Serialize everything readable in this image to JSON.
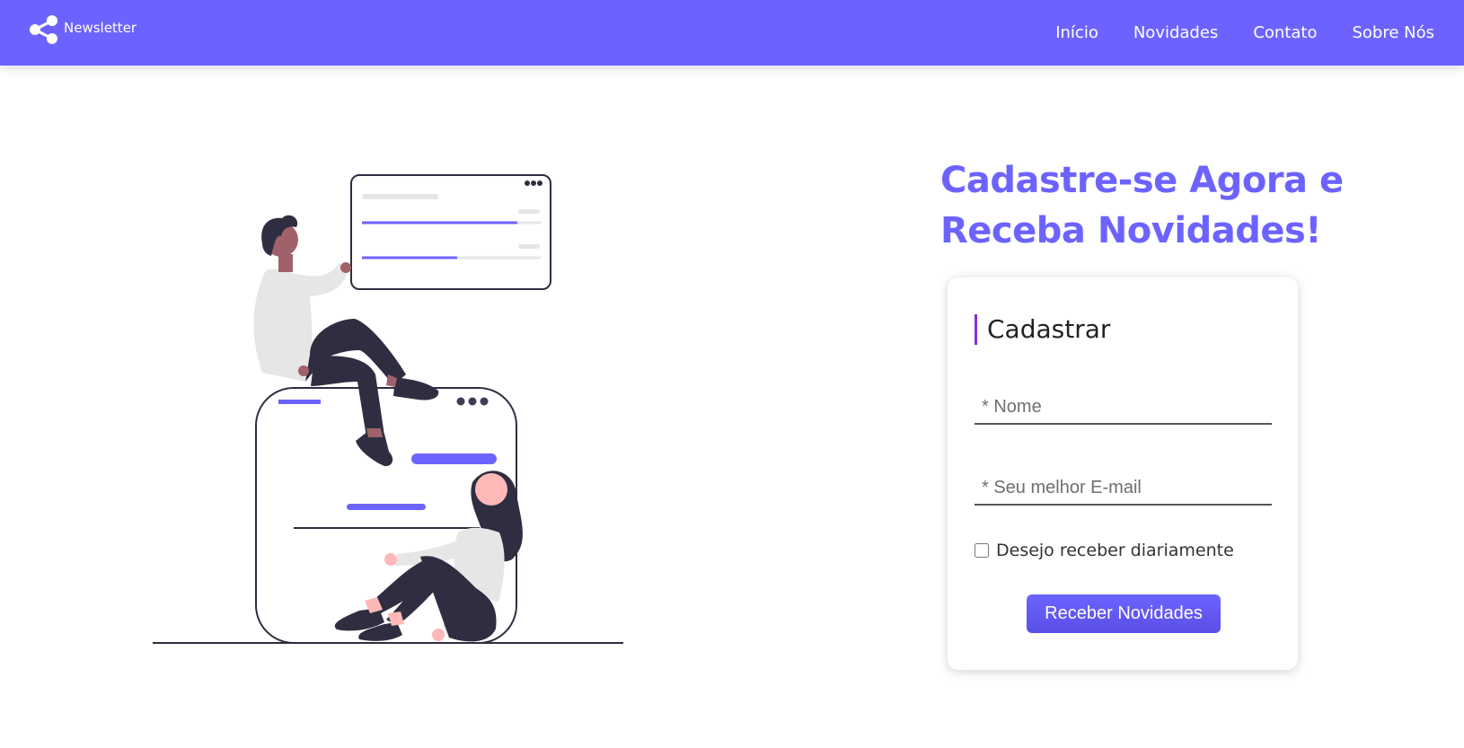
{
  "header": {
    "brand_label": "Newsletter",
    "brand_icon": "share-icon",
    "nav": [
      {
        "label": "Início"
      },
      {
        "label": "Novidades"
      },
      {
        "label": "Contato"
      },
      {
        "label": "Sobre Nós"
      }
    ]
  },
  "hero": {
    "title": "Cadastre-se Agora e Receba Novidades!"
  },
  "form": {
    "title": "Cadastrar",
    "name_placeholder": "* Nome",
    "email_placeholder": "* Seu melhor E-mail",
    "checkbox_label": "Desejo receber diariamente",
    "checkbox_checked": false,
    "submit_label": "Receber Novidades"
  },
  "colors": {
    "primary": "#6c63ff",
    "accent": "#8a2be2",
    "dark": "#2f2e41",
    "skin": "#ffb8b8",
    "light_gray": "#e6e6e6"
  }
}
